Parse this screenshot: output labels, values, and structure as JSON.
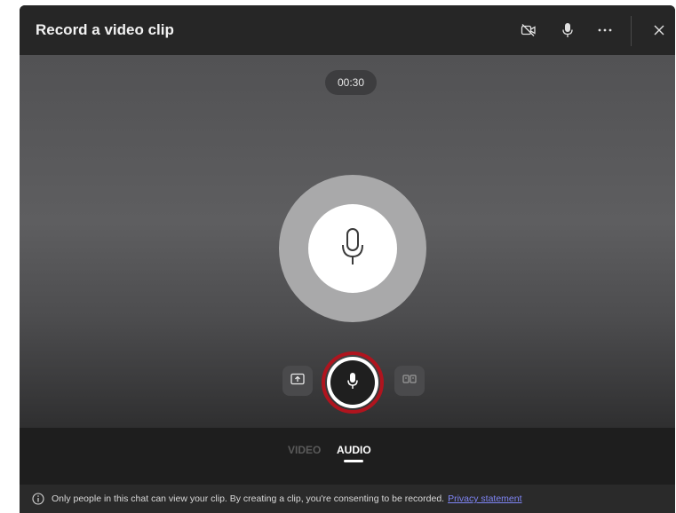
{
  "dialog": {
    "title": "Record a video clip",
    "toolbar": {
      "camera_off_icon": "camera-off-icon",
      "microphone_icon": "microphone-icon",
      "more_options": "...",
      "close_icon": "close-icon"
    }
  },
  "stage": {
    "timer": "00:30",
    "center_icon": "microphone-icon"
  },
  "controls": {
    "left_button_icon": "screen-share-icon",
    "record_button_icon": "microphone-icon",
    "right_button_icon": "effects-icon"
  },
  "modes": {
    "items": [
      {
        "label": "VIDEO",
        "active": false
      },
      {
        "label": "AUDIO",
        "active": true
      }
    ]
  },
  "footer": {
    "notice": "Only people in this chat can view your clip. By creating a clip, you're consenting to be recorded.",
    "privacy_link": "Privacy statement"
  },
  "colors": {
    "record_ring": "#b0141e",
    "link": "#7f85f5"
  }
}
